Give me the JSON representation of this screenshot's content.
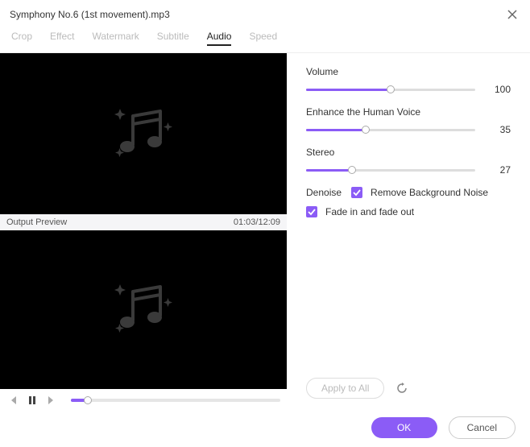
{
  "title": "Symphony No.6 (1st movement).mp3",
  "tabs": {
    "crop": "Crop",
    "effect": "Effect",
    "watermark": "Watermark",
    "subtitle": "Subtitle",
    "audio": "Audio",
    "speed": "Speed"
  },
  "preview": {
    "label": "Output Preview",
    "time": "01:03/12:09",
    "progress_percent": 8
  },
  "audio": {
    "volume": {
      "label": "Volume",
      "value": 100,
      "percent": 50
    },
    "enhance": {
      "label": "Enhance the Human Voice",
      "value": 35,
      "percent": 35
    },
    "stereo": {
      "label": "Stereo",
      "value": 27,
      "percent": 27
    },
    "denoise": {
      "lead": "Denoise",
      "label": "Remove Background Noise",
      "checked": true
    },
    "fade": {
      "label": "Fade in and fade out",
      "checked": true
    }
  },
  "buttons": {
    "apply_all": "Apply to All",
    "ok": "OK",
    "cancel": "Cancel"
  }
}
